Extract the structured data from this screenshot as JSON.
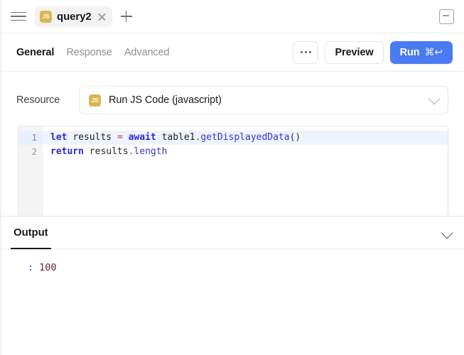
{
  "window": {
    "menu_icon": "hamburger-icon",
    "collapse_icon": "minimize-icon"
  },
  "tabbar": {
    "tabs": [
      {
        "badge": "JS",
        "label": "query2",
        "close_icon": "close-icon",
        "active": true
      }
    ],
    "add_tab_icon": "plus-icon"
  },
  "toolbar": {
    "nav_tabs": [
      {
        "label": "General",
        "active": true
      },
      {
        "label": "Response",
        "active": false
      },
      {
        "label": "Advanced",
        "active": false
      }
    ],
    "more_icon": "ellipsis-icon",
    "preview_label": "Preview",
    "run_label": "Run",
    "run_shortcut": "⌘↩",
    "run_color": "#4a7bf0"
  },
  "resource": {
    "label": "Resource",
    "badge": "JS",
    "value": "Run JS Code (javascript)",
    "chevron_icon": "chevron-down-icon"
  },
  "editor": {
    "line_numbers": [
      "1",
      "2"
    ],
    "active_line": 1,
    "lines": [
      {
        "number": "1",
        "tokens": [
          {
            "text": "let",
            "type": "keyword"
          },
          {
            "text": " ",
            "type": "plain"
          },
          {
            "text": "results",
            "type": "identifier"
          },
          {
            "text": " ",
            "type": "plain"
          },
          {
            "text": "=",
            "type": "operator"
          },
          {
            "text": " ",
            "type": "plain"
          },
          {
            "text": "await",
            "type": "keyword"
          },
          {
            "text": " ",
            "type": "plain"
          },
          {
            "text": "table1",
            "type": "identifier"
          },
          {
            "text": ".",
            "type": "dot"
          },
          {
            "text": "getDisplayedData",
            "type": "property"
          },
          {
            "text": "()",
            "type": "punctuation"
          }
        ],
        "plain": "let results = await table1.getDisplayedData()"
      },
      {
        "number": "2",
        "tokens": [
          {
            "text": "return",
            "type": "keyword"
          },
          {
            "text": " ",
            "type": "plain"
          },
          {
            "text": "results",
            "type": "identifier"
          },
          {
            "text": ".",
            "type": "dot"
          },
          {
            "text": "length",
            "type": "property"
          }
        ],
        "plain": "return results.length"
      }
    ]
  },
  "output": {
    "tab_label": "Output",
    "collapse_icon": "chevron-down-icon",
    "rows": [
      {
        "key": ":",
        "value": "100"
      }
    ]
  }
}
